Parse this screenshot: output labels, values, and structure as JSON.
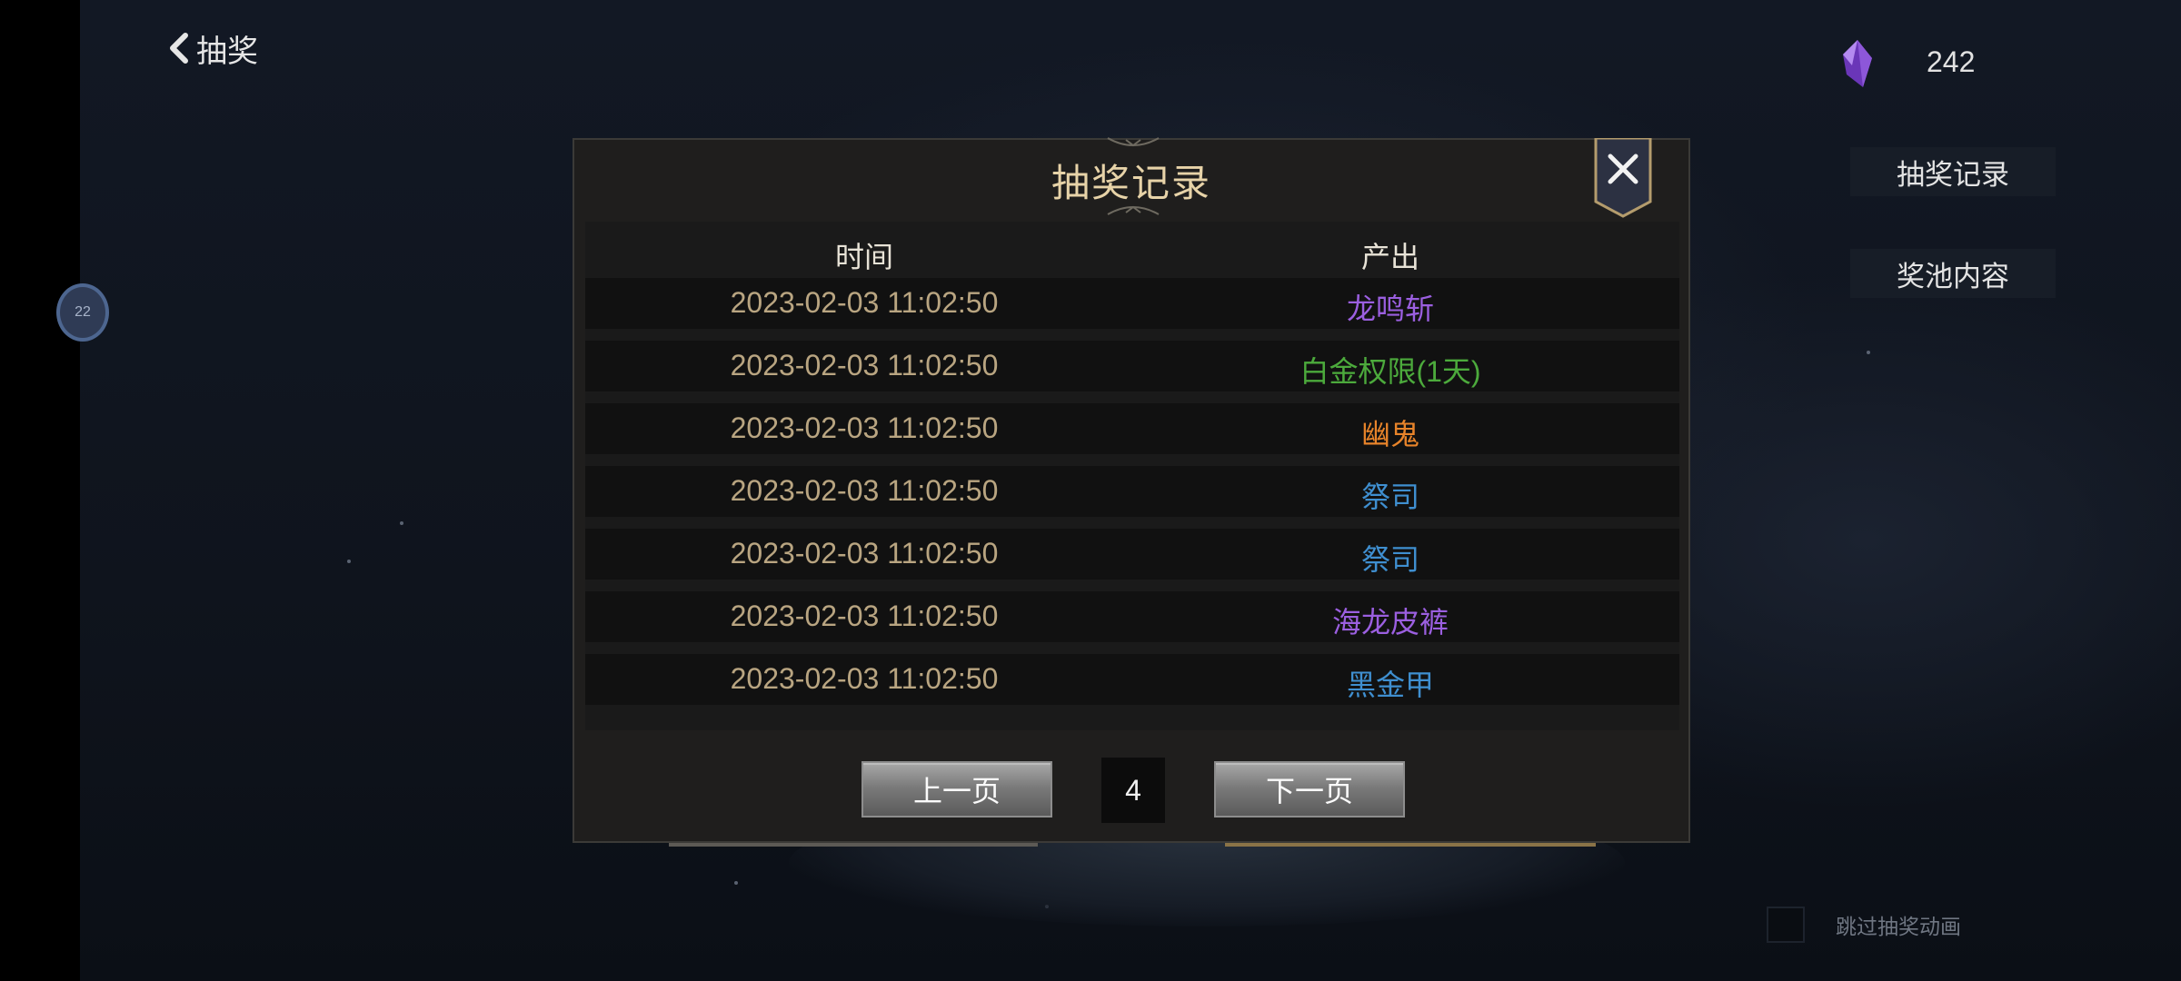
{
  "header": {
    "back_label": "抽奖"
  },
  "currency": {
    "amount": "242",
    "icon": "purple-crystal-icon"
  },
  "sidebar": {
    "records_button": "抽奖记录",
    "pool_button": "奖池内容"
  },
  "left_badge": {
    "text": "22"
  },
  "skip_animation": {
    "label": "跳过抽奖动画",
    "checked": false
  },
  "modal": {
    "title": "抽奖记录",
    "columns": {
      "time": "时间",
      "output": "产出"
    },
    "rows": [
      {
        "time": "2023-02-03 11:02:50",
        "item": "龙鸣斩",
        "color": "#9b5fe0"
      },
      {
        "time": "2023-02-03 11:02:50",
        "item": "白金权限(1天)",
        "color": "#4caa3c"
      },
      {
        "time": "2023-02-03 11:02:50",
        "item": "幽鬼",
        "color": "#e8842a"
      },
      {
        "time": "2023-02-03 11:02:50",
        "item": "祭司",
        "color": "#3f8fd0"
      },
      {
        "time": "2023-02-03 11:02:50",
        "item": "祭司",
        "color": "#3f8fd0"
      },
      {
        "time": "2023-02-03 11:02:50",
        "item": "海龙皮裤",
        "color": "#9b5fe0"
      },
      {
        "time": "2023-02-03 11:02:50",
        "item": "黑金甲",
        "color": "#3f8fd0"
      }
    ],
    "pager": {
      "prev": "上一页",
      "page": "4",
      "next": "下一页"
    }
  }
}
